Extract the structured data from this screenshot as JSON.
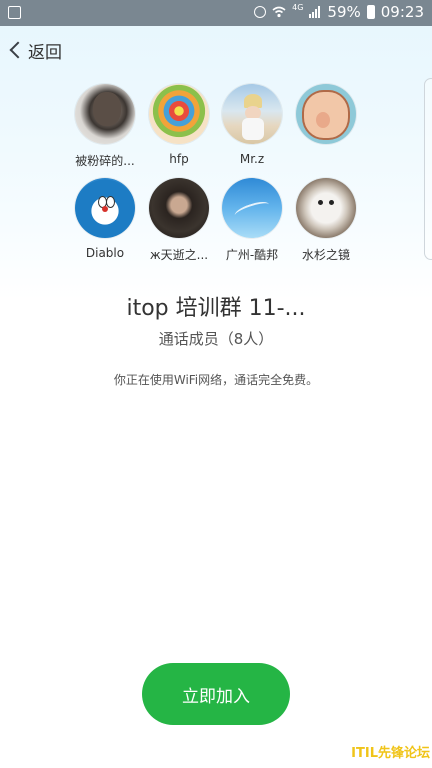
{
  "status_bar": {
    "battery_percent": "59%",
    "time": "09:23",
    "network_type": "4G",
    "icons": [
      "gallery-icon",
      "alarm-icon",
      "wifi-icon",
      "signal-icon",
      "battery-icon"
    ]
  },
  "header": {
    "back_label": "返回"
  },
  "members": [
    {
      "name": "被粉碎的..."
    },
    {
      "name": "hfp"
    },
    {
      "name": "Mr.z"
    },
    {
      "name": ""
    },
    {
      "name": "Diablo"
    },
    {
      "name": "ж天逝之..."
    },
    {
      "name": "广州-酷邦"
    },
    {
      "name": "水杉之镜"
    }
  ],
  "group": {
    "title": "itop 培训群 11-...",
    "members_count": "通话成员（8人）",
    "wifi_note": "你正在使用WiFi网络，通话完全免费。"
  },
  "actions": {
    "join_label": "立即加入"
  },
  "watermark": "ITIL先锋论坛",
  "colors": {
    "join_button": "#25b545",
    "status_bar": "#7a8791",
    "watermark": "#f0c419"
  }
}
